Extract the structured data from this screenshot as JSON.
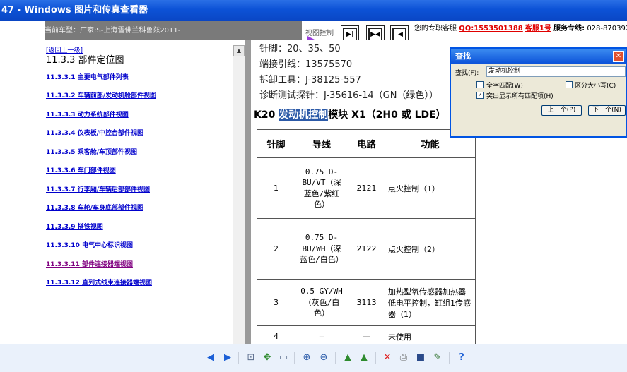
{
  "window": {
    "title": "47 - Windows 图片和传真查看器"
  },
  "infobar": {
    "car_label": "当前车型：厂家:S-上海雪佛兰科鲁兹2011-",
    "view_control": "视图控制"
  },
  "service": {
    "prefix": "您的专职客服",
    "qq": "QQ:1553501388",
    "kefu": "客服1号",
    "hotline_label": "服务专线:",
    "hotline": "028-87039205"
  },
  "nav": {
    "back": "[返回上一级]",
    "heading": "11.3.3 部件定位图",
    "items": [
      {
        "label": "11.3.3.1 主要电气部件列表"
      },
      {
        "label": "11.3.3.2 车辆前部/发动机舱部件视图"
      },
      {
        "label": "11.3.3.3 动力系统部件视图"
      },
      {
        "label": "11.3.3.4 仪表板/中控台部件视图"
      },
      {
        "label": "11.3.3.5 乘客舱/车顶部件视图"
      },
      {
        "label": "11.3.3.6 车门部件视图"
      },
      {
        "label": "11.3.3.7 行李厢/车辆后部部件视图"
      },
      {
        "label": "11.3.3.8 车轮/车身底部部件视图"
      },
      {
        "label": "11.3.3.9 搭铁视图"
      },
      {
        "label": "11.3.3.10 电气中心标识视图"
      },
      {
        "label": "11.3.3.11 部件连接器端视图"
      },
      {
        "label": "11.3.3.12 直列式线束连接器端视图"
      }
    ]
  },
  "doc": {
    "lines": [
      "针脚：20、35、50",
      "端接引线：13575570",
      "拆卸工具：J-38125-557",
      "诊断测试探针：J-35616-14（GN（绿色））"
    ],
    "heading_pre": "K20 ",
    "heading_hl": "发动机控制",
    "heading_post": "模块 X1（2H0 或 LDE）",
    "table": {
      "headers": [
        "针脚",
        "导线",
        "电路",
        "功能"
      ],
      "rows": [
        [
          "1",
          "0.75 D-BU/VT（深蓝色/紫红色）",
          "2121",
          "点火控制（1）"
        ],
        [
          "2",
          "0.75 D-BU/WH（深蓝色/白色）",
          "2122",
          "点火控制（2）"
        ],
        [
          "3",
          "0.5 GY/WH（灰色/白色）",
          "3113",
          "加热型氧传感器加热器低电平控制，缸组1传感器（1）"
        ],
        [
          "4",
          "—",
          "—",
          "未使用"
        ]
      ]
    }
  },
  "find": {
    "title": "查找",
    "label": "查找(F):",
    "value": "发动机控制",
    "whole_word": "全字匹配(W)",
    "match_case": "区分大小写(C)",
    "highlight_all": "突出显示所有匹配项(H)",
    "prev": "上一个(P)",
    "next": "下一个(N)"
  },
  "colors": {
    "accent": "#0a50d8",
    "link": "#0000cc",
    "highlight": "#2c5aa8"
  }
}
